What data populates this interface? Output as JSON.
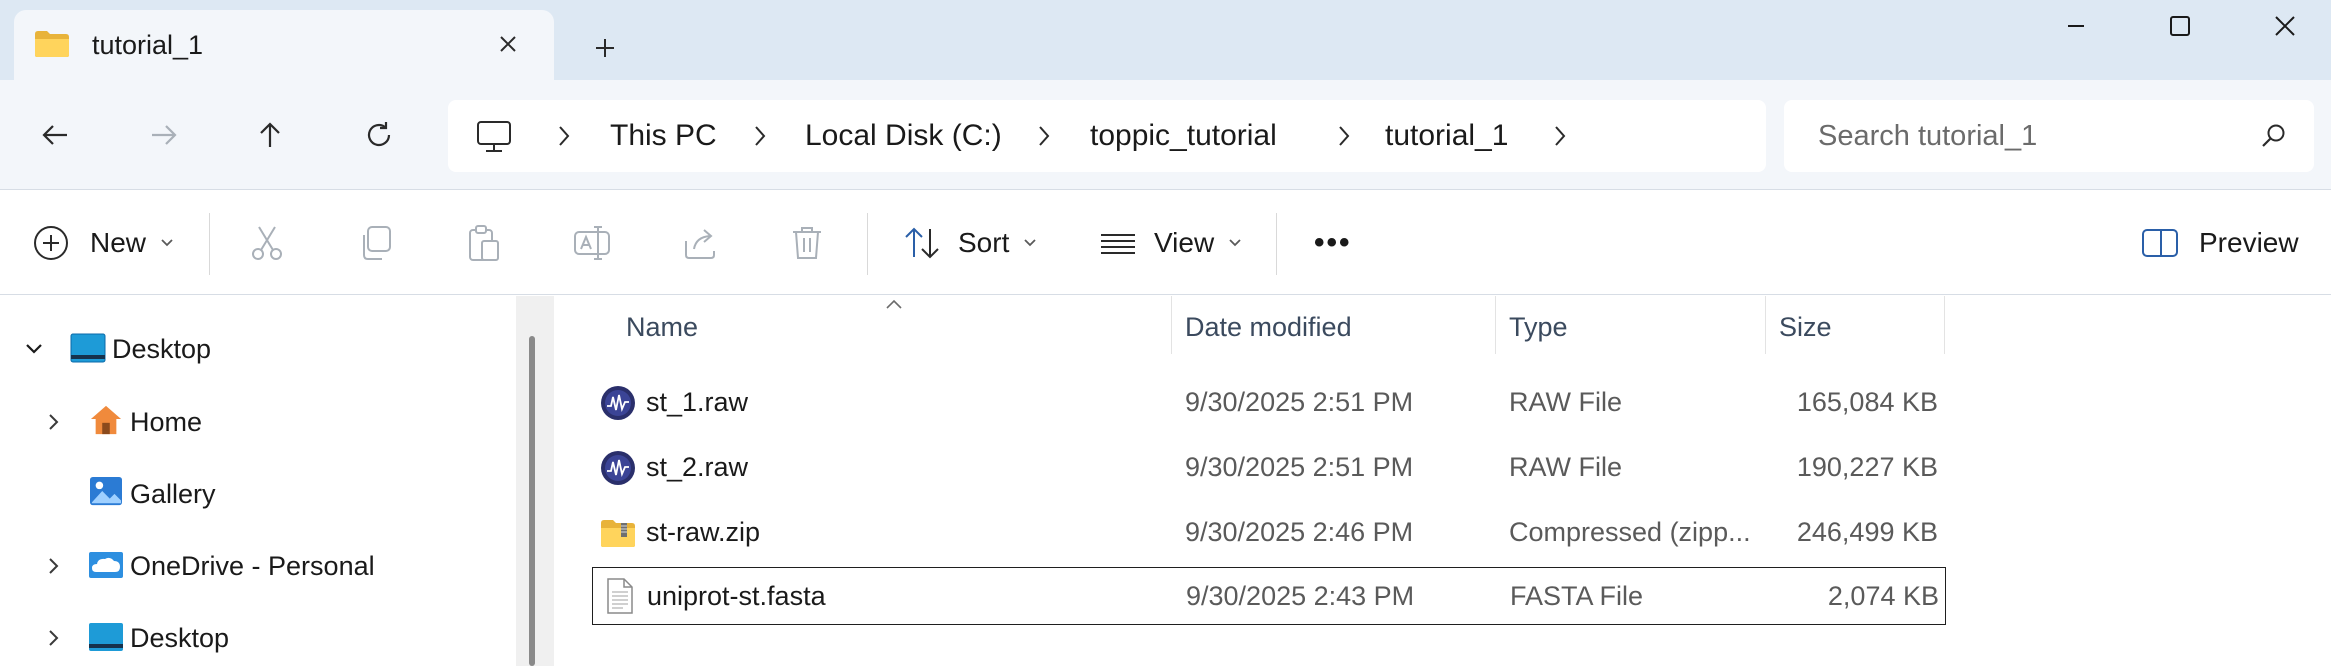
{
  "window": {
    "tab_title": "tutorial_1",
    "new_tab_symbol": "+"
  },
  "nav": {
    "breadcrumb": [
      "This PC",
      "Local Disk (C:)",
      "toppic_tutorial",
      "tutorial_1"
    ],
    "search_placeholder": "Search tutorial_1"
  },
  "toolbar": {
    "new_label": "New",
    "sort_label": "Sort",
    "view_label": "View",
    "more_label": "•••",
    "preview_label": "Preview"
  },
  "sidebar": {
    "items": [
      {
        "label": "Desktop",
        "icon": "desktop-icon",
        "expanded": true
      },
      {
        "label": "Home",
        "icon": "home-icon"
      },
      {
        "label": "Gallery",
        "icon": "gallery-icon"
      },
      {
        "label": "OneDrive - Personal",
        "icon": "onedrive-icon"
      },
      {
        "label": "Desktop",
        "icon": "desktop-icon"
      }
    ]
  },
  "files": {
    "columns": [
      "Name",
      "Date modified",
      "Type",
      "Size"
    ],
    "rows": [
      {
        "name": "st_1.raw",
        "date": "9/30/2025 2:51 PM",
        "type": "RAW File",
        "size": "165,084 KB",
        "icon": "raw-file-icon"
      },
      {
        "name": "st_2.raw",
        "date": "9/30/2025 2:51 PM",
        "type": "RAW File",
        "size": "190,227 KB",
        "icon": "raw-file-icon"
      },
      {
        "name": "st-raw.zip",
        "date": "9/30/2025 2:46 PM",
        "type": "Compressed (zipp...",
        "size": "246,499 KB",
        "icon": "zip-folder-icon"
      },
      {
        "name": "uniprot-st.fasta",
        "date": "9/30/2025 2:43 PM",
        "type": "FASTA File",
        "size": "2,074 KB",
        "icon": "text-file-icon",
        "selected": true
      }
    ]
  },
  "colors": {
    "titlebar": "#dde8f3",
    "navbar": "#f3f6fa",
    "accent": "#0067c0"
  }
}
